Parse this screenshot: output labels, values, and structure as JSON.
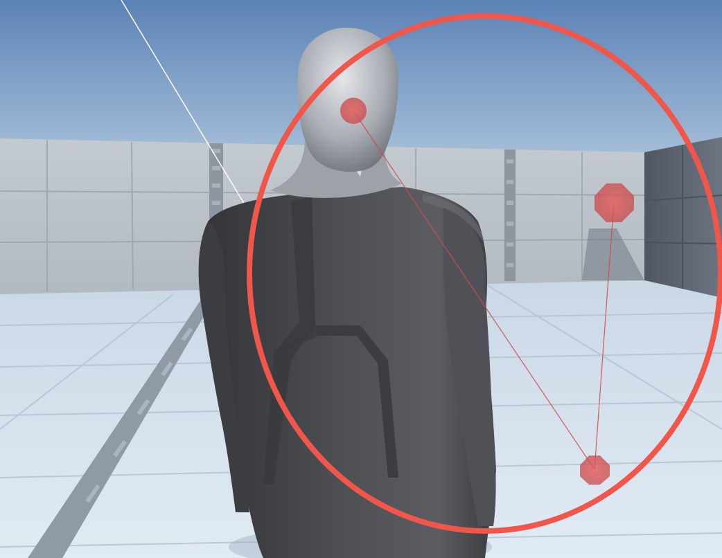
{
  "scene": {
    "sky_color_top": "#5f86b8",
    "sky_color_horizon": "#a9c2dc",
    "wall_color": "#bcc4cb",
    "side_wall_color": "#5d6670",
    "floor_color": "#d6e2ee",
    "character_body_color": "#4a4b4f",
    "character_head_color": "#b8bbc1"
  },
  "gizmo": {
    "ring_color": "#f05a4e",
    "handle_color": "#e05050",
    "ray_color": "#ffffff",
    "handles": [
      {
        "id": "head"
      },
      {
        "id": "wall"
      },
      {
        "id": "floor"
      }
    ]
  }
}
